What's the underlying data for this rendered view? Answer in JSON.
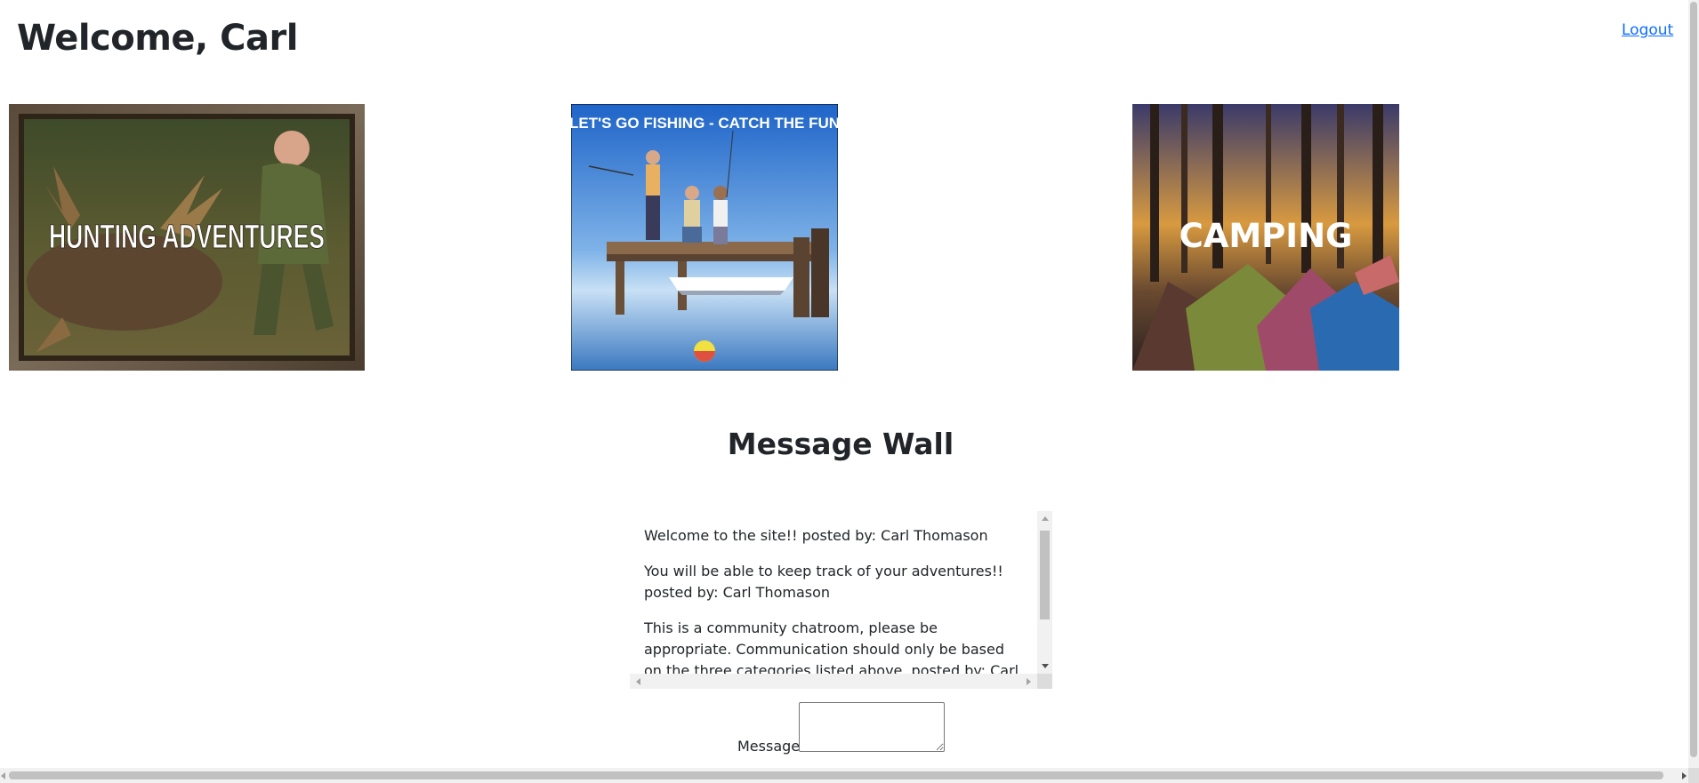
{
  "header": {
    "welcome": "Welcome, Carl",
    "logout_label": "Logout"
  },
  "categories": [
    {
      "id": "hunting",
      "label": "HUNTING ADVENTURES"
    },
    {
      "id": "fishing",
      "label": "LET'S GO FISHING - CATCH THE FUN"
    },
    {
      "id": "camping",
      "label": "CAMPING"
    }
  ],
  "message_wall": {
    "title": "Message Wall",
    "messages": [
      "Welcome to the site!! posted by: Carl Thomason",
      "You will be able to keep track of your adventures!! posted by: Carl Thomason",
      "This is a community chatroom, please be appropriate. Communication should only be based on the three categories listed above. posted by: Carl Thomason"
    ],
    "input_label": "Message:",
    "input_value": ""
  },
  "colors": {
    "link": "#0d6efd",
    "text": "#212529"
  }
}
